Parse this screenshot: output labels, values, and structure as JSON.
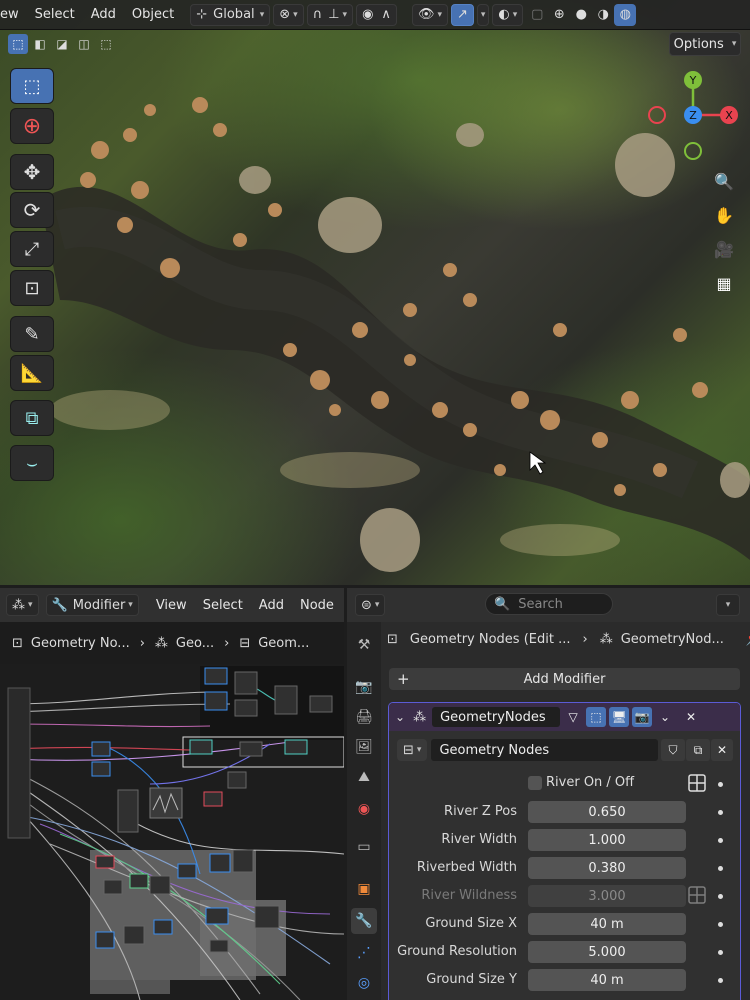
{
  "viewport": {
    "menu": [
      "ew",
      "Select",
      "Add",
      "Object"
    ],
    "transform_orientation": "Global",
    "options_label": "Options",
    "gizmo": {
      "y": "Y",
      "x": "X",
      "z": "Z"
    },
    "tools": [
      "select-box",
      "cursor",
      "move",
      "rotate",
      "scale",
      "transform",
      "annotate",
      "measure",
      "add-cube",
      "shear"
    ]
  },
  "node_editor": {
    "editor_type": "Modifier",
    "menu": [
      "View",
      "Select",
      "Add",
      "Node"
    ],
    "breadcrumb": [
      "Geometry No...",
      "Geo...",
      "Geom..."
    ]
  },
  "properties": {
    "search_placeholder": "Search",
    "breadcrumb": [
      "Geometry Nodes (Edit ...",
      "GeometryNod..."
    ],
    "add_modifier_label": "Add Modifier",
    "modifier": {
      "name": "GeometryNodes",
      "node_group": "Geometry Nodes",
      "toggle_label": "River On / Off",
      "params": [
        {
          "label": "River Z Pos",
          "value": "0.650",
          "enabled": true
        },
        {
          "label": "River Width",
          "value": "1.000",
          "enabled": true
        },
        {
          "label": "Riverbed Width",
          "value": "0.380",
          "enabled": true
        },
        {
          "label": "River Wildness",
          "value": "3.000",
          "enabled": false
        },
        {
          "label": "Ground Size X",
          "value": "40 m",
          "enabled": true
        },
        {
          "label": "Ground Resolution",
          "value": "5.000",
          "enabled": true
        },
        {
          "label": "Ground Size Y",
          "value": "40 m",
          "enabled": true
        }
      ]
    }
  },
  "colors": {
    "accent": "#4772b3",
    "modifier_border": "#5b5bd6",
    "gizmo_x": "#e8434f",
    "gizmo_y": "#7fbf3a",
    "gizmo_z": "#3a8ef0"
  }
}
